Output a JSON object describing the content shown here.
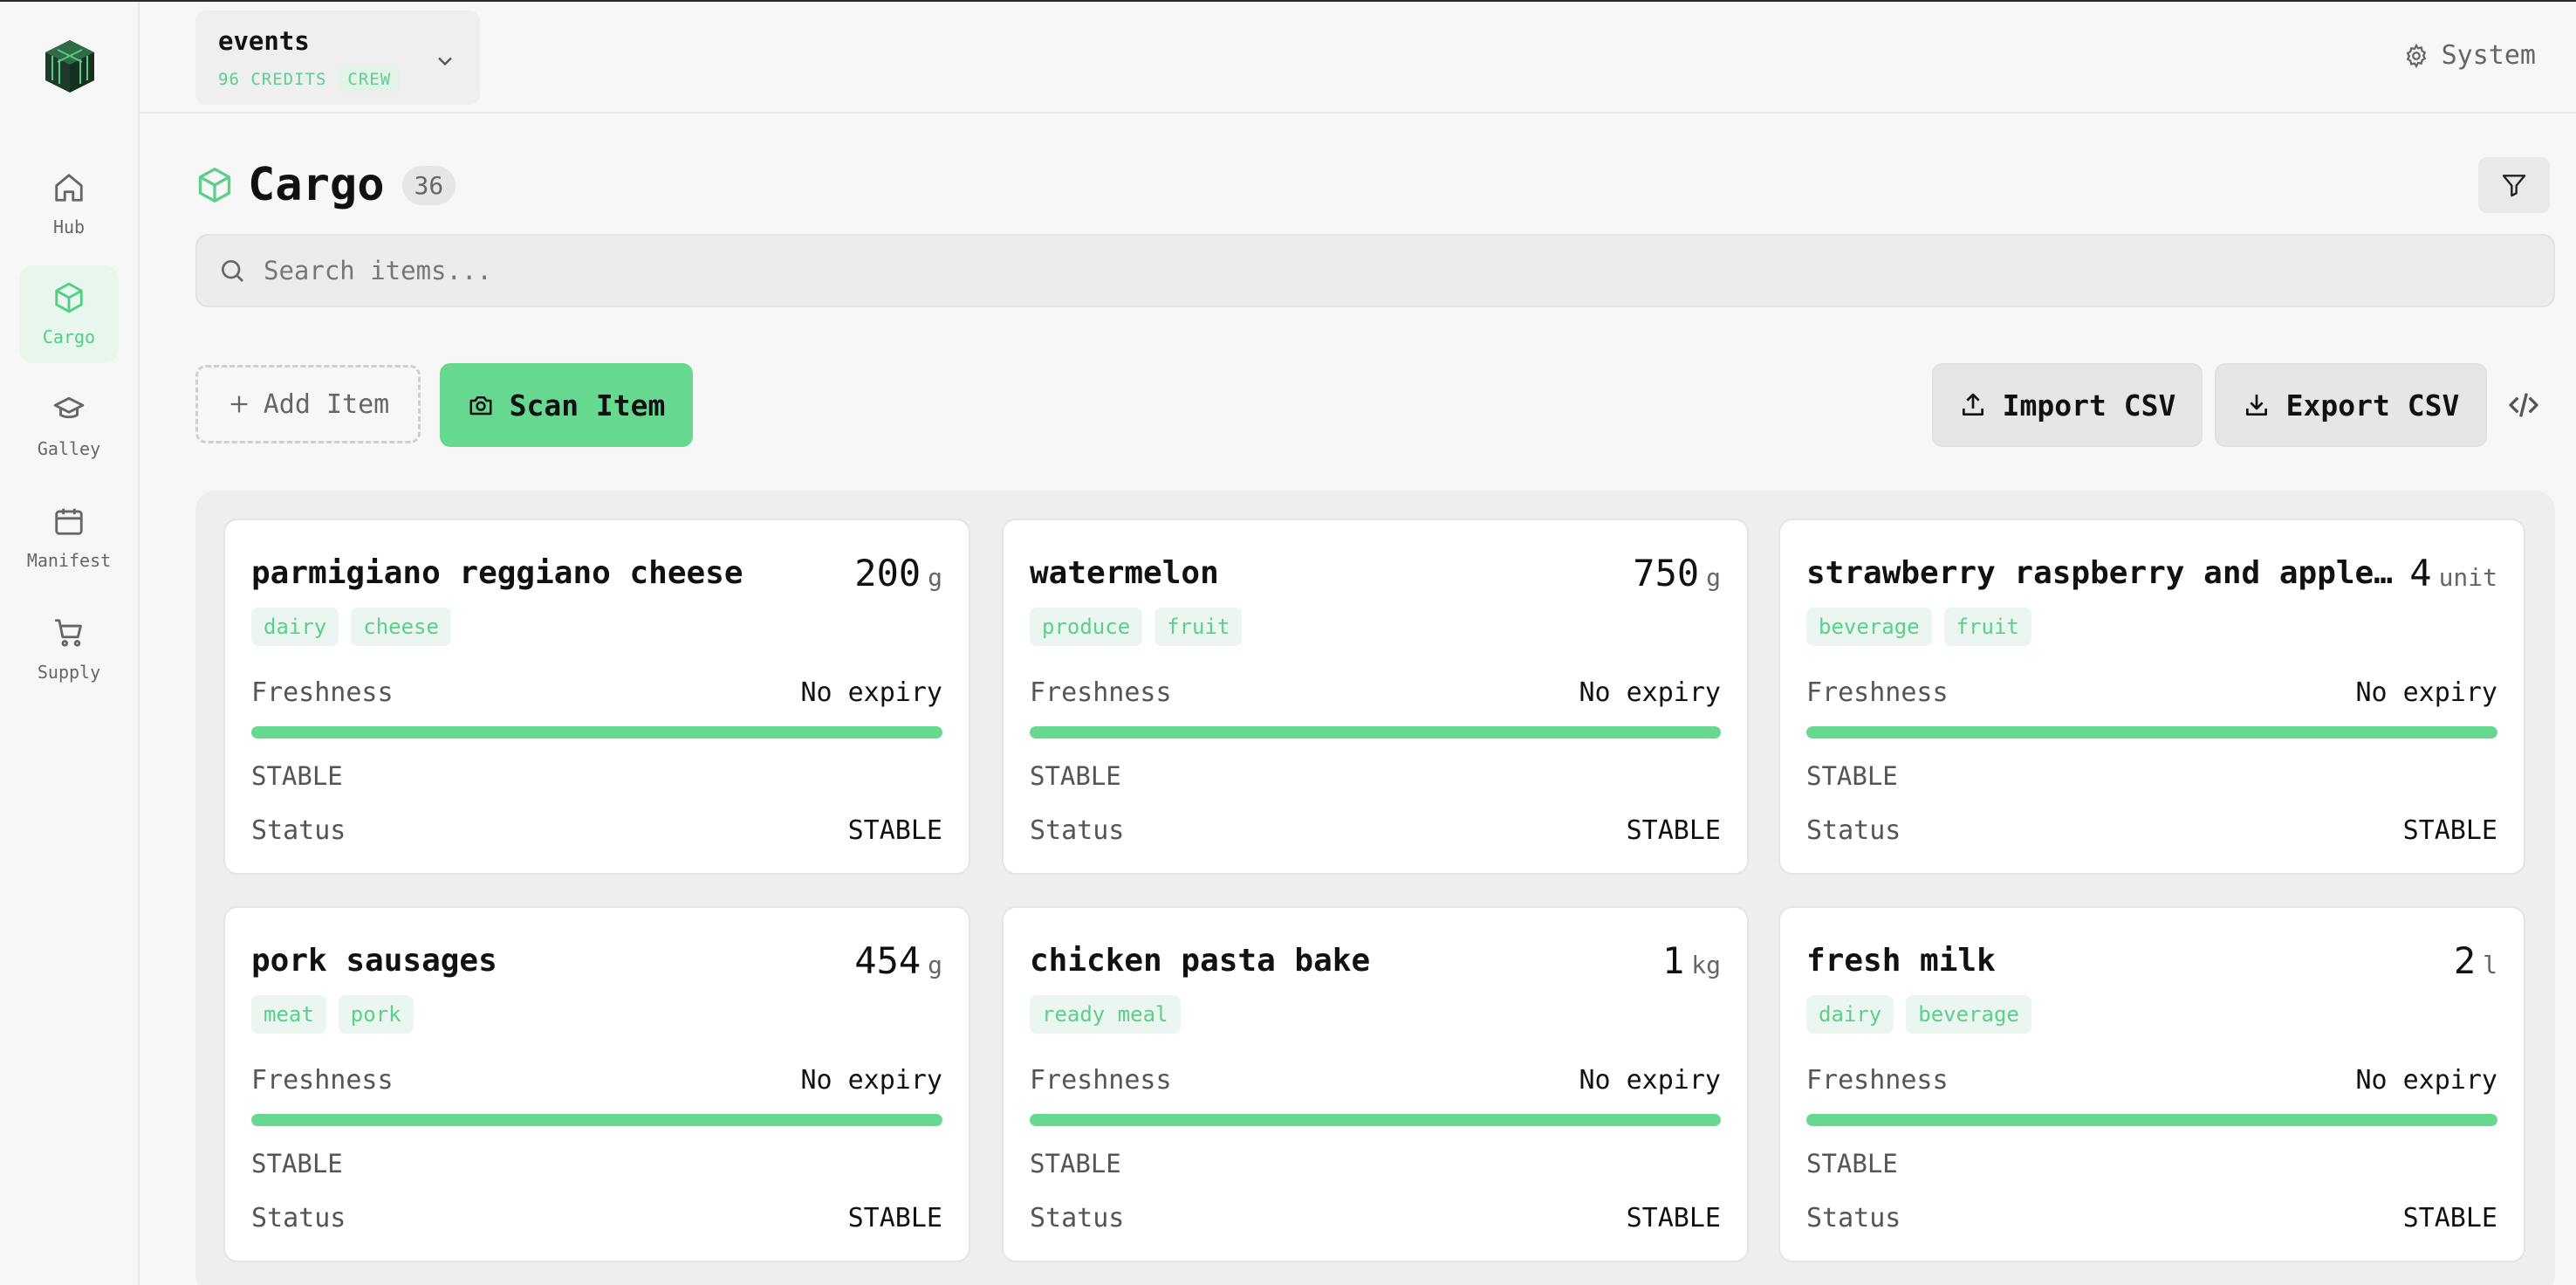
{
  "workspace": {
    "name": "events",
    "credits": "96 CREDITS",
    "role": "CREW"
  },
  "system_label": "System",
  "sidebar": {
    "items": [
      {
        "label": "Hub",
        "icon": "home-icon",
        "active": false
      },
      {
        "label": "Cargo",
        "icon": "cube-icon",
        "active": true
      },
      {
        "label": "Galley",
        "icon": "chef-hat-icon",
        "active": false
      },
      {
        "label": "Manifest",
        "icon": "calendar-icon",
        "active": false
      },
      {
        "label": "Supply",
        "icon": "cart-icon",
        "active": false
      }
    ]
  },
  "page": {
    "title": "Cargo",
    "count": "36"
  },
  "search": {
    "placeholder": "Search items..."
  },
  "toolbar": {
    "add_label": "Add Item",
    "scan_label": "Scan Item",
    "import_label": "Import CSV",
    "export_label": "Export CSV"
  },
  "colors": {
    "accent": "#66d88f",
    "accent_text": "#5ccf8b"
  },
  "items": [
    {
      "name": "parmigiano reggiano cheese",
      "qty": "200",
      "unit": "g",
      "tags": [
        "dairy",
        "cheese"
      ],
      "freshness_label": "Freshness",
      "freshness": "No expiry",
      "freshness_level": 1.0,
      "state": "STABLE",
      "status_label": "Status",
      "status": "STABLE"
    },
    {
      "name": "watermelon",
      "qty": "750",
      "unit": "g",
      "tags": [
        "produce",
        "fruit"
      ],
      "freshness_label": "Freshness",
      "freshness": "No expiry",
      "freshness_level": 1.0,
      "state": "STABLE",
      "status_label": "Status",
      "status": "STABLE"
    },
    {
      "name": "strawberry raspberry and apple…",
      "qty": "4",
      "unit": "unit",
      "tags": [
        "beverage",
        "fruit"
      ],
      "freshness_label": "Freshness",
      "freshness": "No expiry",
      "freshness_level": 1.0,
      "state": "STABLE",
      "status_label": "Status",
      "status": "STABLE"
    },
    {
      "name": "pork sausages",
      "qty": "454",
      "unit": "g",
      "tags": [
        "meat",
        "pork"
      ],
      "freshness_label": "Freshness",
      "freshness": "No expiry",
      "freshness_level": 1.0,
      "state": "STABLE",
      "status_label": "Status",
      "status": "STABLE"
    },
    {
      "name": "chicken pasta bake",
      "qty": "1",
      "unit": "kg",
      "tags": [
        "ready meal"
      ],
      "freshness_label": "Freshness",
      "freshness": "No expiry",
      "freshness_level": 1.0,
      "state": "STABLE",
      "status_label": "Status",
      "status": "STABLE"
    },
    {
      "name": "fresh milk",
      "qty": "2",
      "unit": "l",
      "tags": [
        "dairy",
        "beverage"
      ],
      "freshness_label": "Freshness",
      "freshness": "No expiry",
      "freshness_level": 1.0,
      "state": "STABLE",
      "status_label": "Status",
      "status": "STABLE"
    }
  ]
}
